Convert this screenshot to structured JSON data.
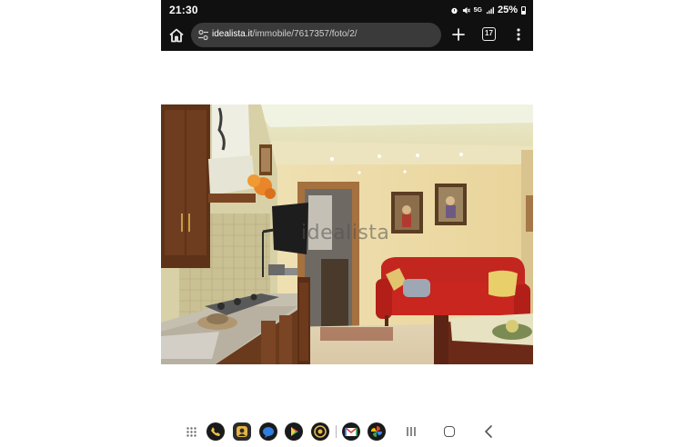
{
  "status_bar": {
    "time": "21:30",
    "network": "5G",
    "battery": "25%",
    "icons": [
      "alarm-icon",
      "mute-icon",
      "signal-icon",
      "battery-icon"
    ]
  },
  "browser": {
    "url_host": "idealista.it",
    "url_path": "/immobile/7617357/foto/2/",
    "tab_count": "17"
  },
  "photo": {
    "watermark": "idealista"
  },
  "taskbar": {
    "apps": [
      "phone-app",
      "contacts-app",
      "messages-app",
      "play-store-app",
      "camera-app",
      "gmail-app",
      "photos-app"
    ]
  },
  "colors": {
    "bar_background": "#101010",
    "url_bar": "#3a3a3a",
    "sofa_red": "#c8261f"
  }
}
